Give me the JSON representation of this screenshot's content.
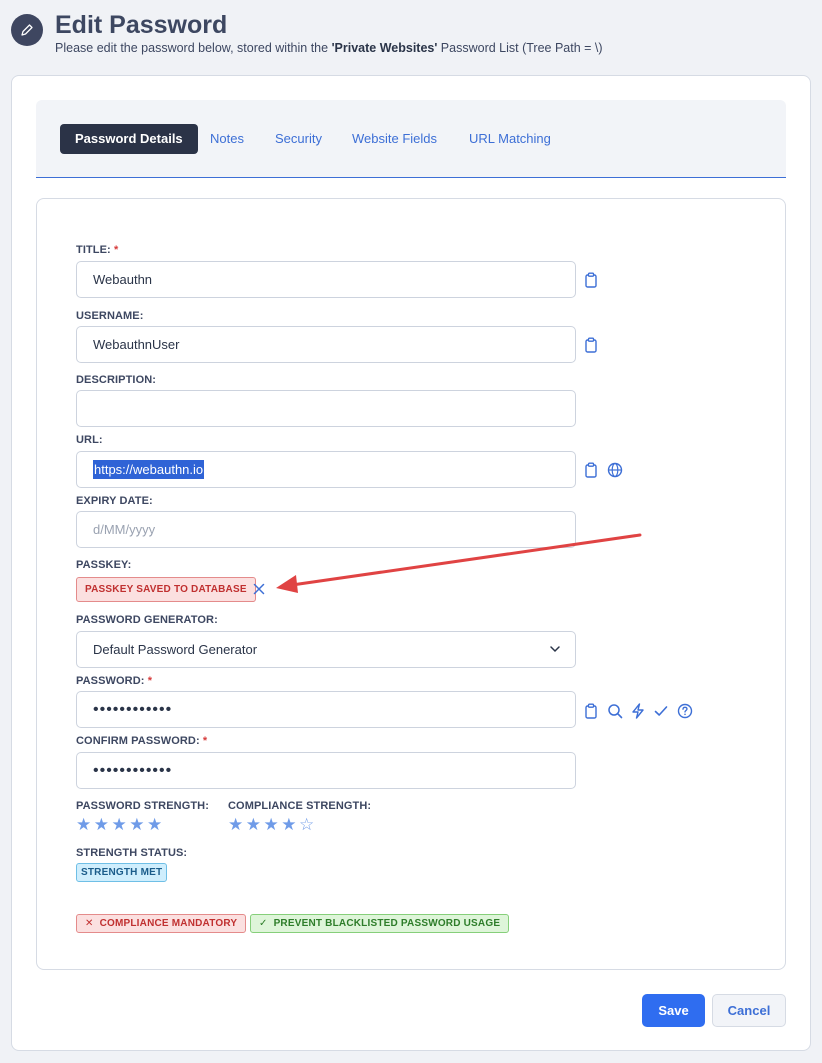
{
  "header": {
    "title": "Edit Password",
    "subtitle_pre": "Please edit the password below, stored within the ",
    "subtitle_bold": "'Private Websites'",
    "subtitle_post": " Password List (Tree Path = \\)"
  },
  "tabs": [
    {
      "label": "Password Details",
      "active": true
    },
    {
      "label": "Notes"
    },
    {
      "label": "Security"
    },
    {
      "label": "Website Fields"
    },
    {
      "label": "URL Matching"
    }
  ],
  "form": {
    "title": {
      "label": "TITLE:",
      "required": "*",
      "value": "Webauthn"
    },
    "username": {
      "label": "USERNAME:",
      "value": "WebauthnUser"
    },
    "description": {
      "label": "DESCRIPTION:",
      "value": ""
    },
    "url": {
      "label": "URL:",
      "value": "https://webauthn.io"
    },
    "expiry": {
      "label": "EXPIRY DATE:",
      "placeholder": "d/MM/yyyy"
    },
    "passkey": {
      "label": "PASSKEY:",
      "badge": "PASSKEY SAVED TO DATABASE"
    },
    "generator": {
      "label": "PASSWORD GENERATOR:",
      "value": "Default Password Generator"
    },
    "password": {
      "label": "PASSWORD:",
      "required": "*",
      "value": "••••••••••••"
    },
    "confirm": {
      "label": "CONFIRM PASSWORD:",
      "required": "*",
      "value": "••••••••••••"
    },
    "password_strength": {
      "label": "PASSWORD STRENGTH:",
      "stars": "★★★★★",
      "rating": 5,
      "max": 5
    },
    "compliance_strength": {
      "label": "COMPLIANCE STRENGTH:",
      "stars": "★★★★☆",
      "rating": 4,
      "max": 5
    },
    "strength_status": {
      "label": "STRENGTH STATUS:",
      "badge": "STRENGTH MET"
    }
  },
  "policies": {
    "compliance": "COMPLIANCE MANDATORY",
    "blacklist": "PREVENT BLACKLISTED PASSWORD USAGE"
  },
  "actions": {
    "save": "Save",
    "cancel": "Cancel"
  },
  "colors": {
    "accent": "#2f6df0",
    "active_tab": "#2b3347",
    "arrow": "#e04343"
  }
}
